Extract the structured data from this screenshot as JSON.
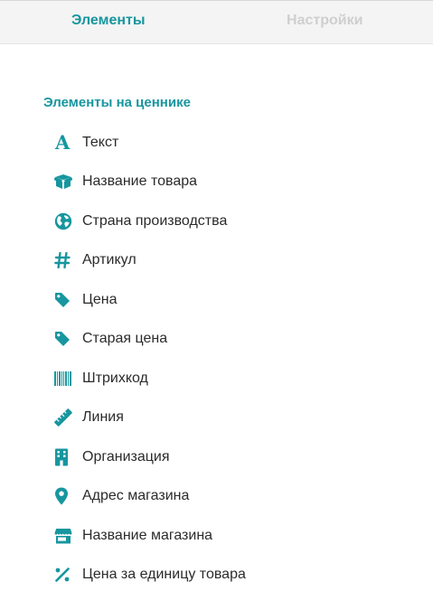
{
  "tabs": [
    {
      "label": "Элементы",
      "active": true
    },
    {
      "label": "Настройки",
      "active": false
    }
  ],
  "section_title": "Элементы на ценнике",
  "icon_letter_text": "A",
  "accent_color": "#17969f",
  "items": [
    {
      "label": "Текст",
      "icon": "text-icon"
    },
    {
      "label": "Название товара",
      "icon": "box-icon"
    },
    {
      "label": "Страна производства",
      "icon": "globe-icon"
    },
    {
      "label": "Артикул",
      "icon": "hashtag-icon"
    },
    {
      "label": "Цена",
      "icon": "tag-icon"
    },
    {
      "label": "Старая цена",
      "icon": "tag-icon"
    },
    {
      "label": "Штрихкод",
      "icon": "barcode-icon"
    },
    {
      "label": "Линия",
      "icon": "ruler-icon"
    },
    {
      "label": "Организация",
      "icon": "building-icon"
    },
    {
      "label": "Адрес магазина",
      "icon": "map-pin-icon"
    },
    {
      "label": "Название магазина",
      "icon": "store-icon"
    },
    {
      "label": "Цена за единицу товара",
      "icon": "percent-icon"
    }
  ]
}
